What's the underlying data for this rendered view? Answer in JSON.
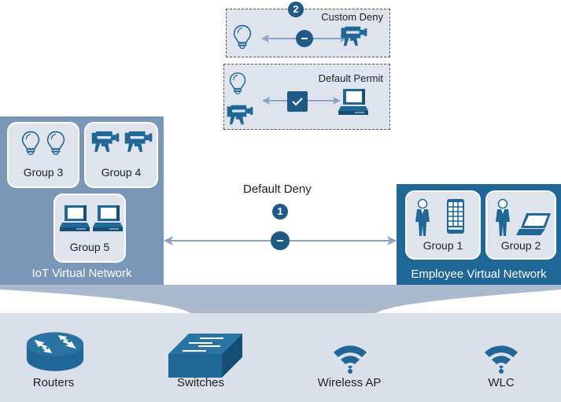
{
  "policies": {
    "custom_deny": {
      "badge": "2",
      "title": "Custom Deny",
      "action": "deny"
    },
    "default_permit": {
      "title": "Default Permit",
      "action": "permit"
    },
    "default_deny": {
      "badge": "1",
      "title": "Default Deny",
      "action": "deny"
    }
  },
  "networks": {
    "iot": {
      "label": "IoT Virtual Network",
      "color": "#7b97b8",
      "groups": [
        {
          "label": "Group 3",
          "icons": [
            "lightbulb-icon",
            "lightbulb-icon"
          ]
        },
        {
          "label": "Group 4",
          "icons": [
            "camera-icon",
            "camera-icon"
          ]
        },
        {
          "label": "Group 5",
          "icons": [
            "desktop-icon",
            "desktop-icon"
          ]
        }
      ]
    },
    "employee": {
      "label": "Employee Virtual Network",
      "color": "#1e6796",
      "groups": [
        {
          "label": "Group 1",
          "icons": [
            "person-icon",
            "smartphone-icon"
          ]
        },
        {
          "label": "Group 2",
          "icons": [
            "person-icon",
            "laptop-icon"
          ]
        }
      ]
    }
  },
  "infrastructure": [
    {
      "label": "Routers",
      "icon": "router-icon"
    },
    {
      "label": "Switches",
      "icon": "switch-icon"
    },
    {
      "label": "Wireless AP",
      "icon": "wireless-icon"
    },
    {
      "label": "WLC",
      "icon": "wireless-icon"
    }
  ],
  "colors": {
    "accent": "#1e6796",
    "badge": "#1e5a85",
    "arrow": "#8aa3c4",
    "box_bg": "#dfe3ec",
    "funnel": "#aab9cf"
  }
}
